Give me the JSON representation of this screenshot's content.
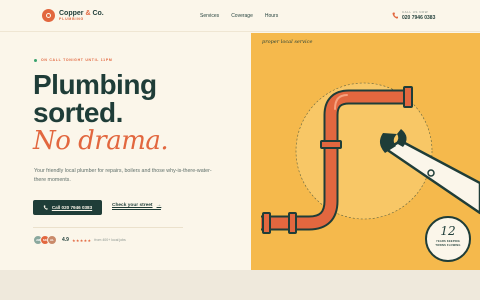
{
  "brand": {
    "name_part1": "Copper",
    "name_amp": "&",
    "name_part2": "Co.",
    "sub": "PLUMBING"
  },
  "nav": {
    "items": [
      "Services",
      "Coverage",
      "Hours"
    ]
  },
  "header_call": {
    "small": "CALL US NOW",
    "number": "020 7946 0383"
  },
  "hero": {
    "oncall": "ON CALL TONIGHT UNTIL 11PM",
    "line1": "Plumbing",
    "line2": "sorted.",
    "line3": "No drama.",
    "lede": "Your friendly local plumber for repairs, boilers and those why-is-there-water-there moments.",
    "cta_call": "Call 020 7946 0383",
    "cta_street": "Check your street",
    "cta_arrow": "→",
    "rating": "4.9",
    "stars": "★★★★★",
    "reviews": "from 400+ local jobs"
  },
  "illustration": {
    "tag": "proper local service",
    "badge_num": "12",
    "badge_line1": "YEARS KEEPING",
    "badge_line2": "TOWNS FLOWING"
  },
  "avatars": [
    {
      "initials": "JM",
      "color": "#8aa89e"
    },
    {
      "initials": "SK",
      "color": "#e2673f"
    },
    {
      "initials": "AL",
      "color": "#c98a6a"
    }
  ],
  "colors": {
    "accent": "#e2673f",
    "dark": "#1f3d38",
    "panel": "#f5b94c",
    "cream": "#fbf6ea"
  }
}
